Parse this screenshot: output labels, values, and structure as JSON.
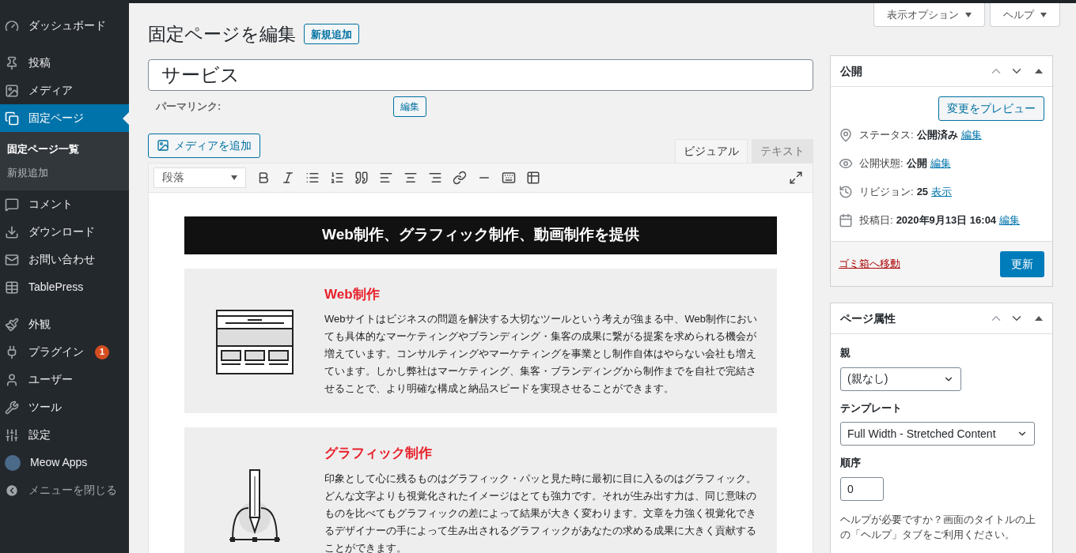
{
  "sidebar": {
    "groups": [
      {
        "items": [
          {
            "label": "ダッシュボード",
            "selected": false
          }
        ]
      },
      {
        "items": [
          {
            "label": "投稿",
            "selected": false
          },
          {
            "label": "メディア",
            "selected": false
          },
          {
            "label": "固定ページ",
            "selected": true,
            "children": [
              {
                "label": "固定ページ一覧",
                "selected": true
              },
              {
                "label": "新規追加",
                "selected": false
              }
            ]
          },
          {
            "label": "コメント",
            "selected": false
          },
          {
            "label": "ダウンロード",
            "selected": false
          },
          {
            "label": "お問い合わせ",
            "selected": false
          },
          {
            "label": "TablePress",
            "selected": false
          }
        ]
      },
      {
        "items": [
          {
            "label": "外観",
            "selected": false
          },
          {
            "label": "プラグイン",
            "selected": false,
            "badge": "1"
          },
          {
            "label": "ユーザー",
            "selected": false
          },
          {
            "label": "ツール",
            "selected": false
          },
          {
            "label": "設定",
            "selected": false
          },
          {
            "label": "Meow Apps",
            "selected": false
          }
        ]
      }
    ],
    "collapse_label": "メニューを閉じる"
  },
  "screen_buttons": [
    "表示オプション",
    "ヘルプ"
  ],
  "heading": "固定ページを編集",
  "add_new": "新規追加",
  "title_value": "サービス",
  "permalink": {
    "label": "パーマリンク:",
    "button": "編集"
  },
  "add_media": "メディアを追加",
  "editor_tabs": [
    {
      "label": "ビジュアル",
      "selected": true
    },
    {
      "label": "テキスト",
      "selected": false
    }
  ],
  "format_select": "段落",
  "content": {
    "banner": "Web制作、グラフィック制作、動画制作を提供",
    "services": [
      {
        "kind": "web",
        "title": "Web制作",
        "text": "Webサイトはビジネスの問題を解決する大切なツールという考えが強まる中、Web制作においても具体的なマーケティングやブランディング・集客の成果に繋がる提案を求められる機会が増えています。コンサルティングやマーケティングを事業とし制作自体はやらない会社も増えています。しかし弊社はマーケティング、集客・ブランディングから制作までを自社で完結させることで、より明確な構成と納品スピードを実現させることができます。"
      },
      {
        "kind": "graphic",
        "title": "グラフィック制作",
        "text": "印象として心に残るものはグラフィック・パッと見た時に最初に目に入るのはグラフィック。どんな文字よりも視覚化されたイメージはとても強力です。それが生み出す力は、同じ意味のものを比べてもグラフィックの差によって結果が大きく変わります。文章を力強く視覚化できるデザイナーの手によって生み出されるグラフィックがあなたの求める成果に大きく貢献することができます。"
      }
    ]
  },
  "publish": {
    "title": "公開",
    "preview": "変更をプレビュー",
    "rows": [
      {
        "kind": "status",
        "label": "ステータス:",
        "value": "公開済み",
        "link": "編集"
      },
      {
        "kind": "visibility",
        "label": "公開状態:",
        "value": "公開",
        "link": "編集"
      },
      {
        "kind": "revisions",
        "label": "リビジョン:",
        "value": "25",
        "link": "表示"
      },
      {
        "kind": "date",
        "label": "投稿日:",
        "value": "2020年9月13日 16:04",
        "link": "編集"
      }
    ],
    "trash": "ゴミ箱へ移動",
    "update": "更新"
  },
  "attributes": {
    "title": "ページ属性",
    "parent_label": "親",
    "parent_value": "(親なし)",
    "template_label": "テンプレート",
    "template_value": "Full Width - Stretched Content",
    "order_label": "順序",
    "order_value": "0",
    "help": "ヘルプが必要ですか？画面のタイトルの上の「ヘルプ」タブをご利用ください。"
  }
}
